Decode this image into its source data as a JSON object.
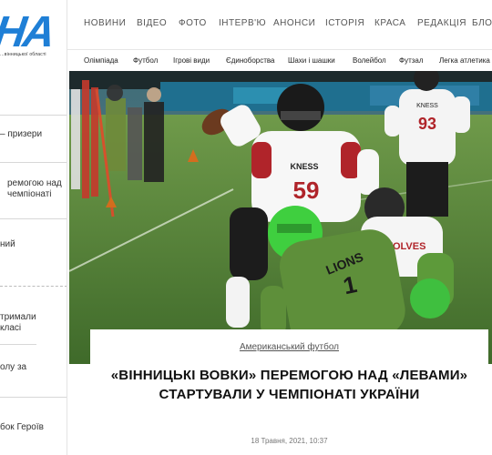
{
  "site": {
    "logo": "НА",
    "logo_sub": "...вінницької області"
  },
  "left_column": {
    "items": [
      {
        "label": "– призери"
      },
      {
        "label": "ремогою над"
      },
      {
        "label": "чемпіонаті"
      },
      {
        "label": "ний"
      },
      {
        "label": "тримали"
      },
      {
        "label": "класі"
      },
      {
        "label": "олу за"
      },
      {
        "label": "бок Героїв"
      }
    ]
  },
  "nav": {
    "items": [
      "НОВИНИ",
      "ВІДЕО",
      "ФОТО",
      "ІНТЕРВ'Ю",
      "АНОНСИ",
      "ІСТОРІЯ",
      "КРАСА",
      "РЕДАКЦІЯ",
      "БЛОГ"
    ]
  },
  "subnav": {
    "items": [
      "Олімпіада",
      "Футбол",
      "Ігрові види",
      "Єдиноборства",
      "Шахи і шашки",
      "Волейбол",
      "Футзал",
      "Легка атлетика"
    ]
  },
  "hero": {
    "jersey_front_brand": "KNESS",
    "jersey_front_number": "59",
    "jersey_back_brand": "KNESS",
    "jersey_back_number": "93",
    "lion_jersey_text": "LIONS",
    "lion_jersey_number": "1",
    "wolves_jersey_text": "WOLVES"
  },
  "article": {
    "category": "Американський футбол",
    "headline": "«ВІННИЦЬКІ ВОВКИ» ПЕРЕМОГОЮ НАД «ЛЕВАМИ» СТАРТУВАЛИ У ЧЕМПІОНАТІ УКРАЇНИ",
    "date": "18 Травня, 2021, 10:37"
  }
}
